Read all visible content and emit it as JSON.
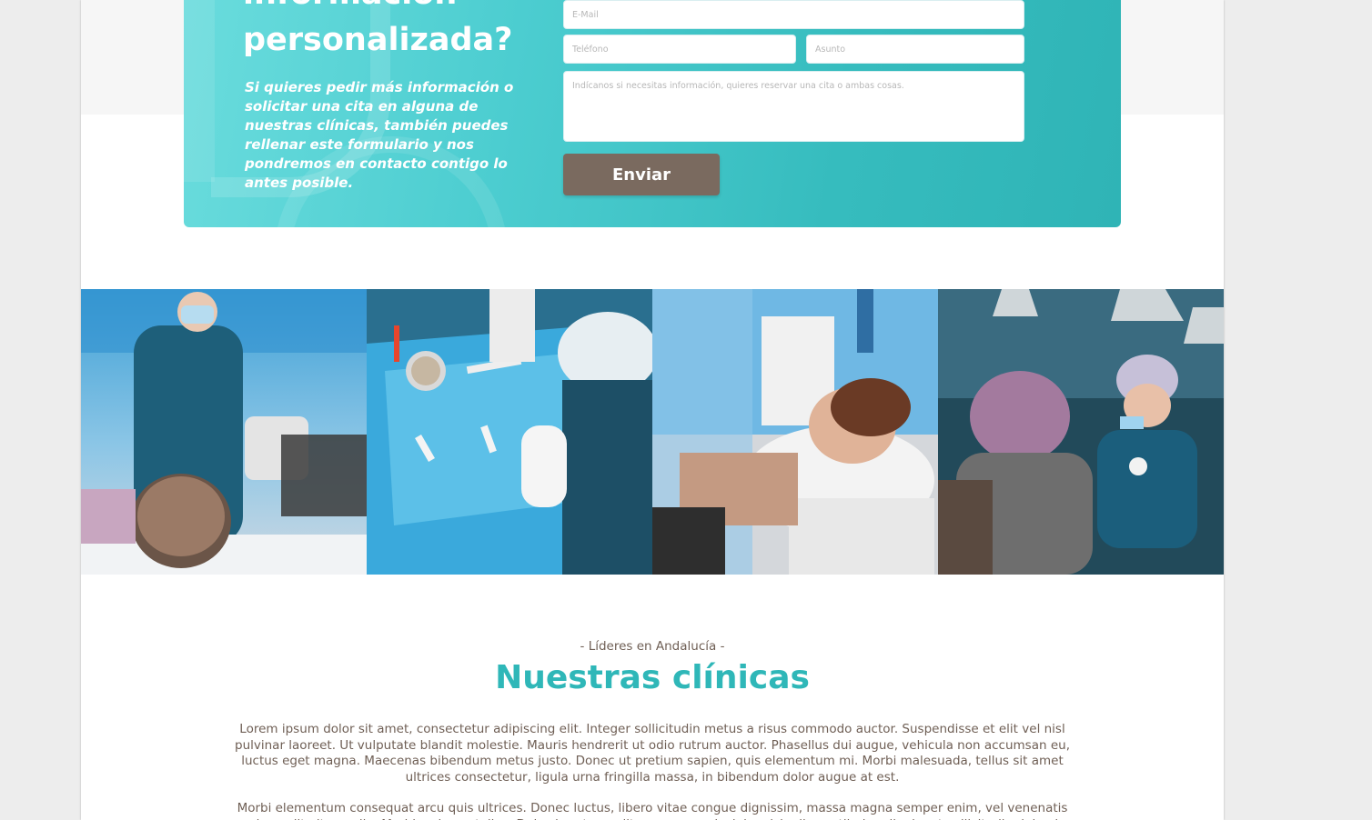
{
  "contact": {
    "heading_line1": "información",
    "heading_line2": "personalizada?",
    "description": "Si quieres pedir más información o solicitar una cita en alguna de nuestras clínicas, también puedes rellenar este formulario y nos pondremos en contacto contigo lo antes posible.",
    "form": {
      "email_placeholder": "E-Mail",
      "phone_placeholder": "Teléfono",
      "subject_placeholder": "Asunto",
      "message_placeholder": "Indícanos si necesitas información, quieres reservar una cita o ambas cosas.",
      "submit_label": "Enviar"
    }
  },
  "gallery": {
    "photos": [
      {
        "icon": "clinic-photo-patient-treatment"
      },
      {
        "icon": "clinic-photo-instrument-tray"
      },
      {
        "icon": "clinic-photo-patient-chair"
      },
      {
        "icon": "clinic-photo-surgery-team"
      }
    ]
  },
  "clinics": {
    "kicker": "- Líderes en Andalucía -",
    "title": "Nuestras clínicas",
    "paragraphs": [
      "Lorem ipsum dolor sit amet, consectetur adipiscing elit. Integer sollicitudin metus a risus commodo auctor. Suspendisse et elit vel nisl pulvinar laoreet. Ut vulputate blandit molestie. Mauris hendrerit ut odio rutrum auctor. Phasellus dui augue, vehicula non accumsan eu, luctus eget magna. Maecenas bibendum metus justo. Donec ut pretium sapien, quis elementum mi. Morbi malesuada, tellus sit amet ultrices consectetur, ligula urna fringilla massa, in bibendum dolor augue at est.",
      "Morbi elementum consequat arcu quis ultrices. Donec luctus, libero vitae congue dignissim, massa magna semper enim, vel venenatis sapien velit vitae nulla. Morbi sed sem tellus. Duis pharetra, velit nec semper lacinia, nisl odio vestibulum ligula, et sollicitudin dui enim eu"
    ]
  },
  "colors": {
    "accent_teal": "#2fb7b8",
    "button_brown": "#7a6a5f",
    "text_brown": "#6f5f55"
  }
}
